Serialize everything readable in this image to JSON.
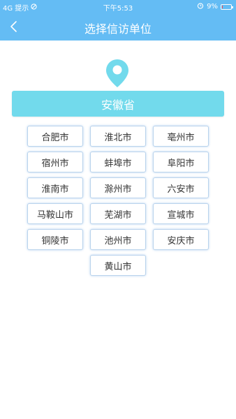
{
  "status_bar": {
    "carrier": "4G 提示",
    "time": "下午5:53",
    "battery": "9%",
    "battery_level": 0.09
  },
  "nav": {
    "title": "选择信访单位",
    "back_icon": "chevron-left-icon"
  },
  "location_icon": "map-pin-icon",
  "province": "安徽省",
  "cities": [
    "合肥市",
    "淮北市",
    "亳州市",
    "宿州市",
    "蚌埠市",
    "阜阳市",
    "淮南市",
    "滁州市",
    "六安市",
    "马鞍山市",
    "芜湖市",
    "宣城市",
    "铜陵市",
    "池州市",
    "安庆市",
    "黄山市"
  ],
  "colors": {
    "header": "#64bcf4",
    "province_bar": "#72daec",
    "pin": "#72daec",
    "battery_low": "#ff4d4d"
  }
}
